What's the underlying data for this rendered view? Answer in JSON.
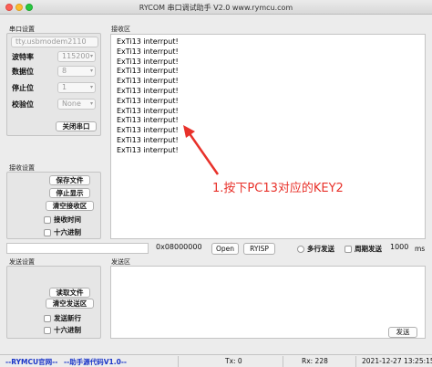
{
  "window": {
    "title": "RYCOM 串口调试助手 V2.0 www.rymcu.com"
  },
  "serial_settings": {
    "group_label": "串口设置",
    "port": "tty.usbmodem2110",
    "baud_label": "波特率",
    "baud": "115200",
    "data_bits_label": "数据位",
    "data_bits": "8",
    "stop_bits_label": "停止位",
    "stop_bits": "1",
    "parity_label": "校验位",
    "parity": "None",
    "close_port": "关闭串口"
  },
  "receive_settings": {
    "group_label": "接收设置",
    "save_file": "保存文件",
    "stop_display": "停止显示",
    "clear_receive": "清空接收区",
    "receive_time": "接收时间",
    "hex": "十六进制"
  },
  "receive_area": {
    "label": "接收区",
    "lines": [
      "ExTi13 interrput!",
      "ExTi13 interrput!",
      "ExTi13 interrput!",
      "ExTi13 interrput!",
      "ExTi13 interrput!",
      "ExTi13 interrput!",
      "ExTi13 interrput!",
      "ExTi13 interrput!",
      "ExTi13 interrput!",
      "ExTi13 interrput!",
      "ExTi13 interrput!",
      "ExTi13 interrput!"
    ]
  },
  "annotation": {
    "text": "1.按下PC13对应的KEY2",
    "color": "#e8312a"
  },
  "file_row": {
    "path": "",
    "address": "0x08000000",
    "open": "Open",
    "ryisp": "RYISP",
    "multi_send": "多行发送",
    "periodic_send": "周期发送",
    "period": "1000",
    "unit": "ms"
  },
  "send_settings": {
    "group_label": "发送设置",
    "read_file": "读取文件",
    "clear_send": "清空发送区",
    "send_newline": "发送新行",
    "hex": "十六进制"
  },
  "send_area": {
    "label": "发送区",
    "send": "发送"
  },
  "status_bar": {
    "link1": "--RYMCU官网--",
    "link2": "--助手源代码V1.0--",
    "tx": "Tx: 0",
    "rx": "Rx: 228",
    "datetime": "2021-12-27 13:25:15"
  },
  "colors": {
    "accent_link": "#1a35c8",
    "annotation": "#e8312a"
  }
}
